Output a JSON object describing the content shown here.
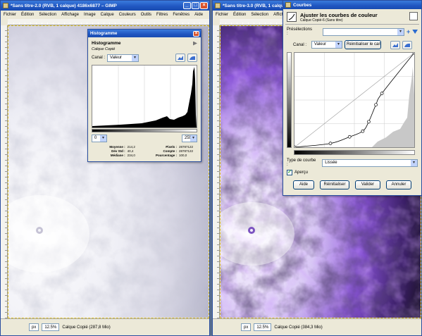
{
  "left_window": {
    "title": "*Sans titre-2.0 (RVB, 1 calque) 4186x6877 – GIMP",
    "menu": [
      "Fichier",
      "Édition",
      "Sélection",
      "Affichage",
      "Image",
      "Calque",
      "Couleurs",
      "Outils",
      "Filtres",
      "Fenêtres",
      "Aide"
    ],
    "status": {
      "unit": "px",
      "zoom": "12.5%",
      "layer": "Calque Copié (287,8 Mio)"
    }
  },
  "right_window": {
    "title": "*Sans titre-3.0 (RVB, 1 calque",
    "menu": [
      "Fichier",
      "Édition",
      "Sélection",
      "Affichage"
    ],
    "status": {
      "unit": "px",
      "zoom": "12.5%",
      "layer": "Calque Copié (384,3 Mio)"
    }
  },
  "histogram": {
    "window_title": "Histogramme",
    "heading": "Histogramme",
    "layer": "Calque Copié",
    "channel_label": "Canal :",
    "channel_value": "Valeur",
    "range_min": "0",
    "range_max": "255",
    "stats": [
      {
        "k": "Moyenne :",
        "v": "214,2",
        "k2": "Pixels :",
        "v2": "28787122"
      },
      {
        "k": "Dév Std :",
        "v": "40,4",
        "k2": "Compte :",
        "v2": "28787122"
      },
      {
        "k": "Médiane :",
        "v": "234,0",
        "k2": "Pourcentage :",
        "v2": "100,0"
      }
    ]
  },
  "curves": {
    "window_title": "Courbes",
    "heading": "Ajuster les courbes de couleur",
    "layer": "Calque Copié-6 (Sans titre)",
    "presets_label": "Présélections :",
    "channel_label": "Canal :",
    "channel_value": "Valeur",
    "reset_channel": "Réinitialiser le canal",
    "curve_type_label": "Type de courbe :",
    "curve_type_value": "Lissée",
    "preview_label": "Aperçu",
    "buttons": {
      "help": "Aide",
      "reset": "Réinitialiser",
      "ok": "Valider",
      "cancel": "Annuler"
    },
    "curve_points": [
      [
        0,
        0
      ],
      [
        0.3,
        0.04
      ],
      [
        0.46,
        0.11
      ],
      [
        0.57,
        0.17
      ],
      [
        0.62,
        0.27
      ],
      [
        0.68,
        0.45
      ],
      [
        0.73,
        0.57
      ],
      [
        1,
        1
      ]
    ]
  },
  "colors": {
    "titlebar": "#1f55c0",
    "dialog_bg": "#ece9d8",
    "purple": "#7a3fd0"
  }
}
